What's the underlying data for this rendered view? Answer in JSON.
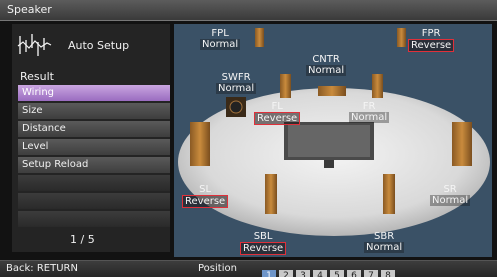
{
  "window": {
    "title": "Speaker"
  },
  "sidebar": {
    "heading": "Auto Setup",
    "section_label": "Result",
    "items": [
      {
        "label": "Wiring",
        "selected": true
      },
      {
        "label": "Size"
      },
      {
        "label": "Distance"
      },
      {
        "label": "Level"
      },
      {
        "label": "Setup Reload"
      },
      {
        "label": ""
      },
      {
        "label": ""
      },
      {
        "label": ""
      }
    ],
    "page_indicator": "1 / 5"
  },
  "speakers": {
    "fpl": {
      "name": "FPL",
      "status": "Normal"
    },
    "fpr": {
      "name": "FPR",
      "status": "Reverse"
    },
    "cntr": {
      "name": "CNTR",
      "status": "Normal"
    },
    "swfr": {
      "name": "SWFR",
      "status": "Normal"
    },
    "fl": {
      "name": "FL",
      "status": "Reverse"
    },
    "fr": {
      "name": "FR",
      "status": "Normal"
    },
    "sl": {
      "name": "SL",
      "status": "Reverse"
    },
    "sr": {
      "name": "SR",
      "status": "Normal"
    },
    "sbl": {
      "name": "SBL",
      "status": "Reverse"
    },
    "sbr": {
      "name": "SBR",
      "status": "Normal"
    }
  },
  "footer": {
    "back_label": "Back: RETURN",
    "position_label": "Position",
    "positions": [
      "1",
      "2",
      "3",
      "4",
      "5",
      "6",
      "7",
      "8"
    ],
    "active_position": "1"
  },
  "colors": {
    "selected_item": "#9a6cc0",
    "reverse_border": "#e0303a",
    "active_position": "#6e95c9"
  }
}
